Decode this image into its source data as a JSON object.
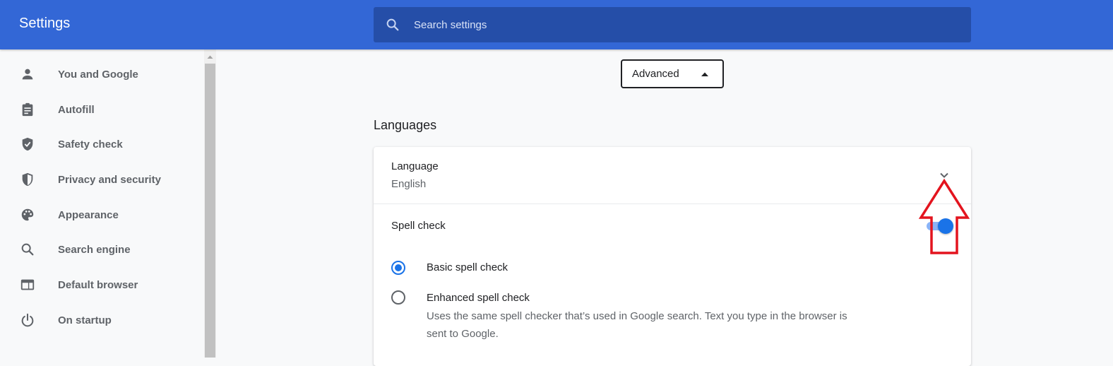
{
  "header": {
    "title": "Settings",
    "search_placeholder": "Search settings",
    "search_icon": "search-icon"
  },
  "sidebar": {
    "items": [
      {
        "label": "You and Google",
        "icon": "person-icon"
      },
      {
        "label": "Autofill",
        "icon": "clipboard-icon"
      },
      {
        "label": "Safety check",
        "icon": "shield-check-icon"
      },
      {
        "label": "Privacy and security",
        "icon": "shield-half-icon"
      },
      {
        "label": "Appearance",
        "icon": "palette-icon"
      },
      {
        "label": "Search engine",
        "icon": "search-icon"
      },
      {
        "label": "Default browser",
        "icon": "browser-window-icon"
      },
      {
        "label": "On startup",
        "icon": "power-icon"
      }
    ]
  },
  "main": {
    "advanced_button": "Advanced",
    "section_title": "Languages",
    "language": {
      "label": "Language",
      "value": "English"
    },
    "spell_check": {
      "label": "Spell check",
      "enabled": true,
      "options": [
        {
          "label": "Basic spell check",
          "selected": true
        },
        {
          "label": "Enhanced spell check",
          "selected": false,
          "description": "Uses the same spell checker that’s used in Google search. Text you type in the browser is sent to Google."
        }
      ]
    }
  },
  "colors": {
    "header_bg": "#3367d6",
    "search_bg": "#254ea8",
    "accent": "#1a73e8",
    "annotation": "#e3141e"
  }
}
